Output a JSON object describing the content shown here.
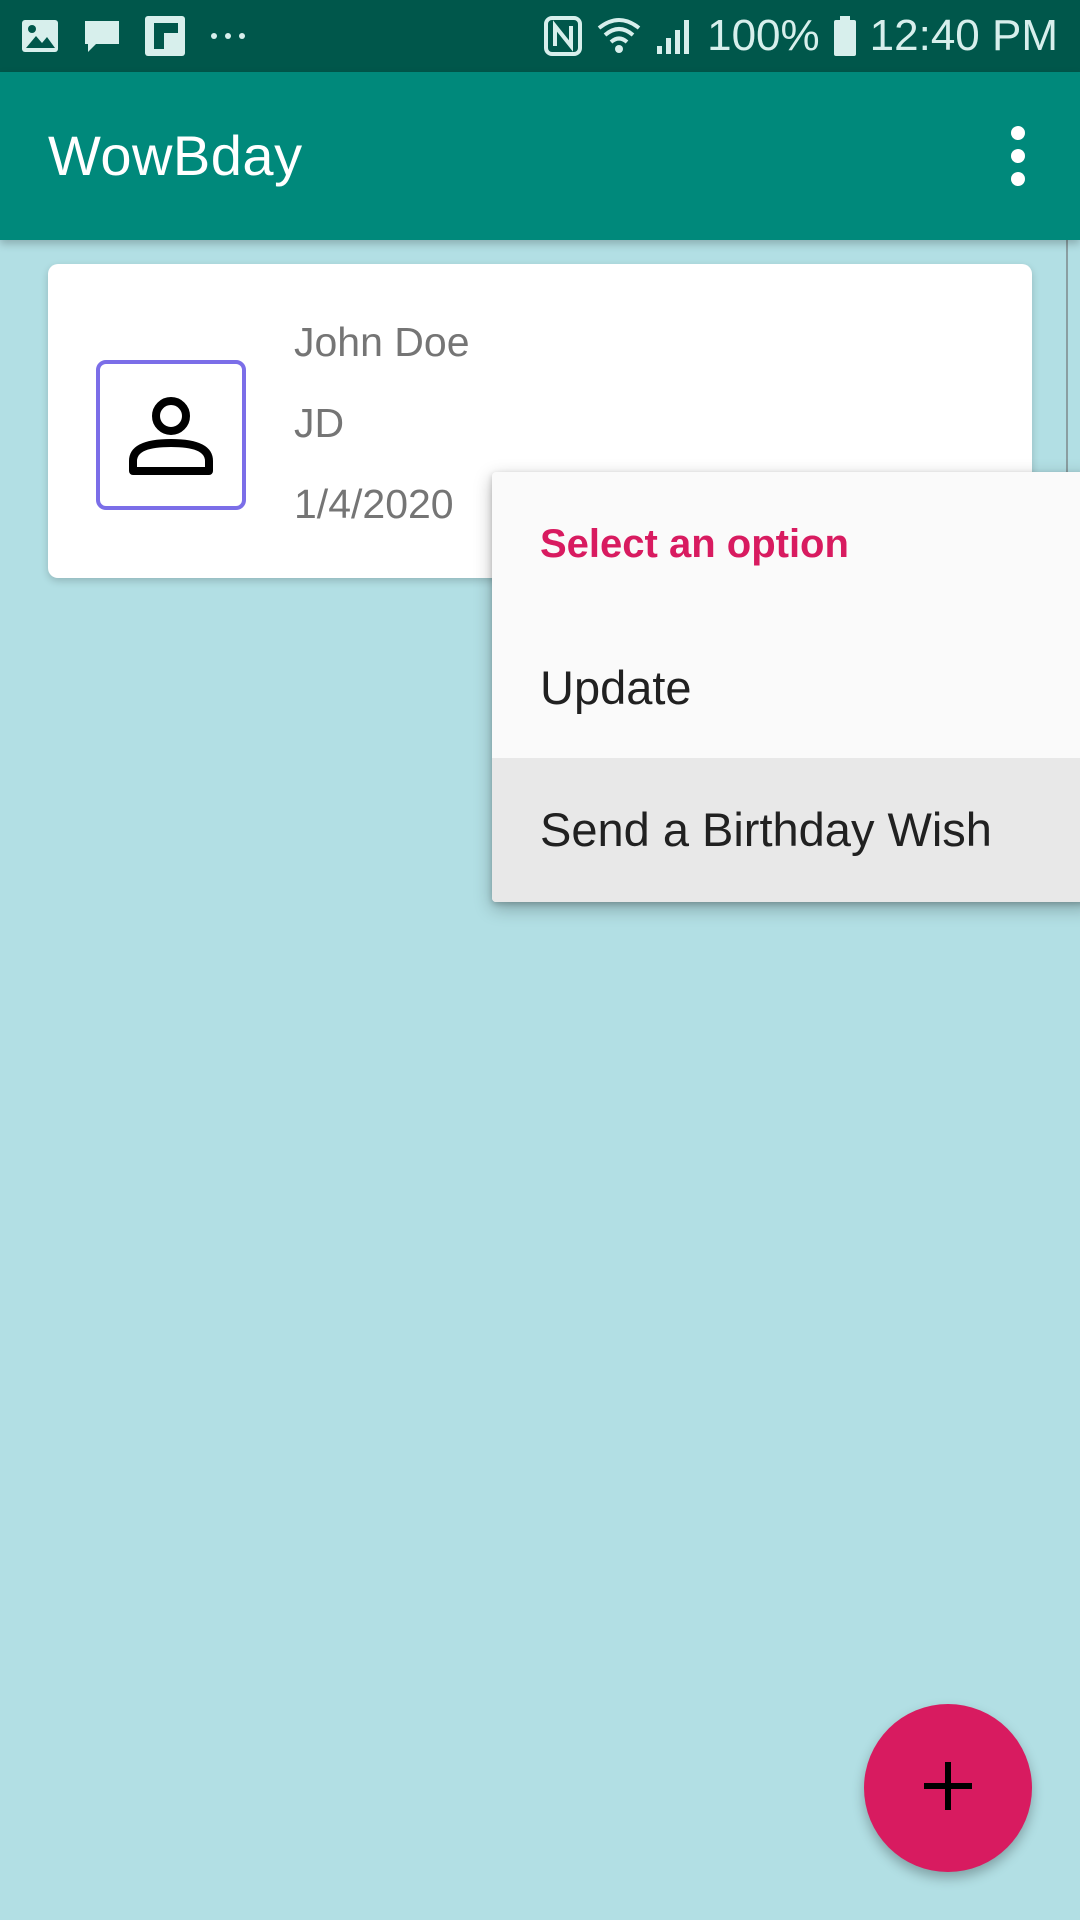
{
  "status_bar": {
    "left_icons": [
      "gallery-icon",
      "chat-icon",
      "flipboard-icon",
      "more-notifications-icon"
    ],
    "right_icons": [
      "nfc-icon",
      "wifi-icon",
      "signal-icon",
      "battery-icon"
    ],
    "battery": "100%",
    "time": "12:40 PM"
  },
  "app_bar": {
    "title": "WowBday",
    "overflow_icon": "more-vert-icon"
  },
  "card": {
    "avatar_icon": "person-icon",
    "name": "John Doe",
    "initials": "JD",
    "date": "1/4/2020"
  },
  "menu": {
    "title": "Select an option",
    "items": [
      {
        "label": "Update"
      },
      {
        "label": "Send a Birthday Wish"
      }
    ]
  },
  "fab": {
    "icon": "plus-icon"
  },
  "colors": {
    "status_bar": "#00574b",
    "app_bar": "#00897b",
    "background": "#b2dfe4",
    "accent": "#d81b60",
    "avatar_border": "#7b6ee8",
    "menu_highlight": "#e8e8e8"
  }
}
